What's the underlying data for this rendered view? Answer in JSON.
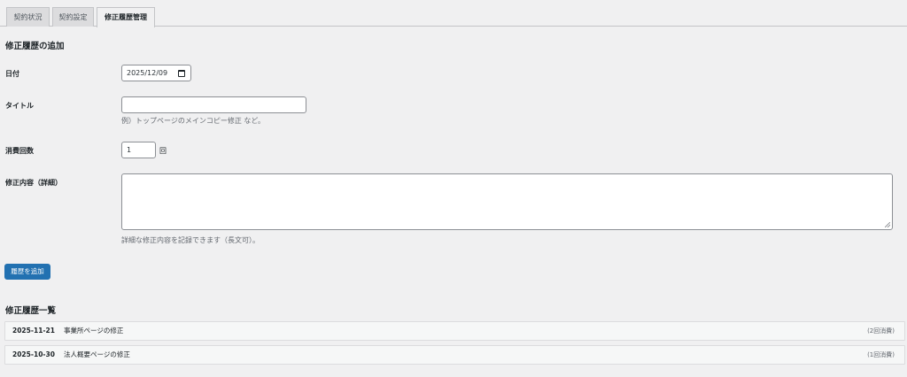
{
  "tabs": [
    {
      "label": "契約状況"
    },
    {
      "label": "契約設定"
    },
    {
      "label": "修正履歴管理",
      "active": true
    }
  ],
  "add_section": {
    "title": "修正履歴の追加",
    "date_label": "日付",
    "date_value": "2025/12/09",
    "title_label": "タイトル",
    "title_value": "",
    "title_hint": "例）トップページのメインコピー修正 など。",
    "count_label": "消費回数",
    "count_value": "1",
    "count_unit": "回",
    "detail_label": "修正内容（詳細）",
    "detail_value": "",
    "detail_hint": "詳細な修正内容を記録できます（長文可）。",
    "submit_label": "履歴を追加"
  },
  "history": {
    "title": "修正履歴一覧",
    "items": [
      {
        "date": "2025-11-21",
        "title": "事業所ページの修正",
        "usage": "(2回消費)"
      },
      {
        "date": "2025-10-30",
        "title": "法人概要ページの修正",
        "usage": "(1回消費)"
      }
    ]
  },
  "colors": {
    "primary": "#2271b1",
    "background": "#f0f0f1",
    "row_background": "#f6f7f7"
  }
}
